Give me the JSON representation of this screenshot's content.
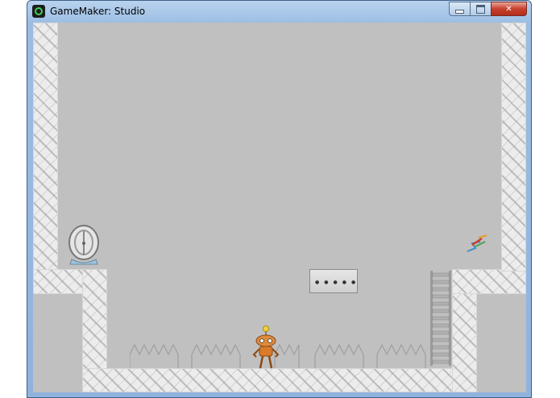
{
  "window": {
    "title": "GameMaker: Studio",
    "controls": {
      "minimize": "minimize",
      "maximize": "maximize",
      "close": "✕"
    }
  },
  "game": {
    "background_color": "#c0c0c0",
    "wall_color": "#ececec",
    "spike_groups": 5
  }
}
